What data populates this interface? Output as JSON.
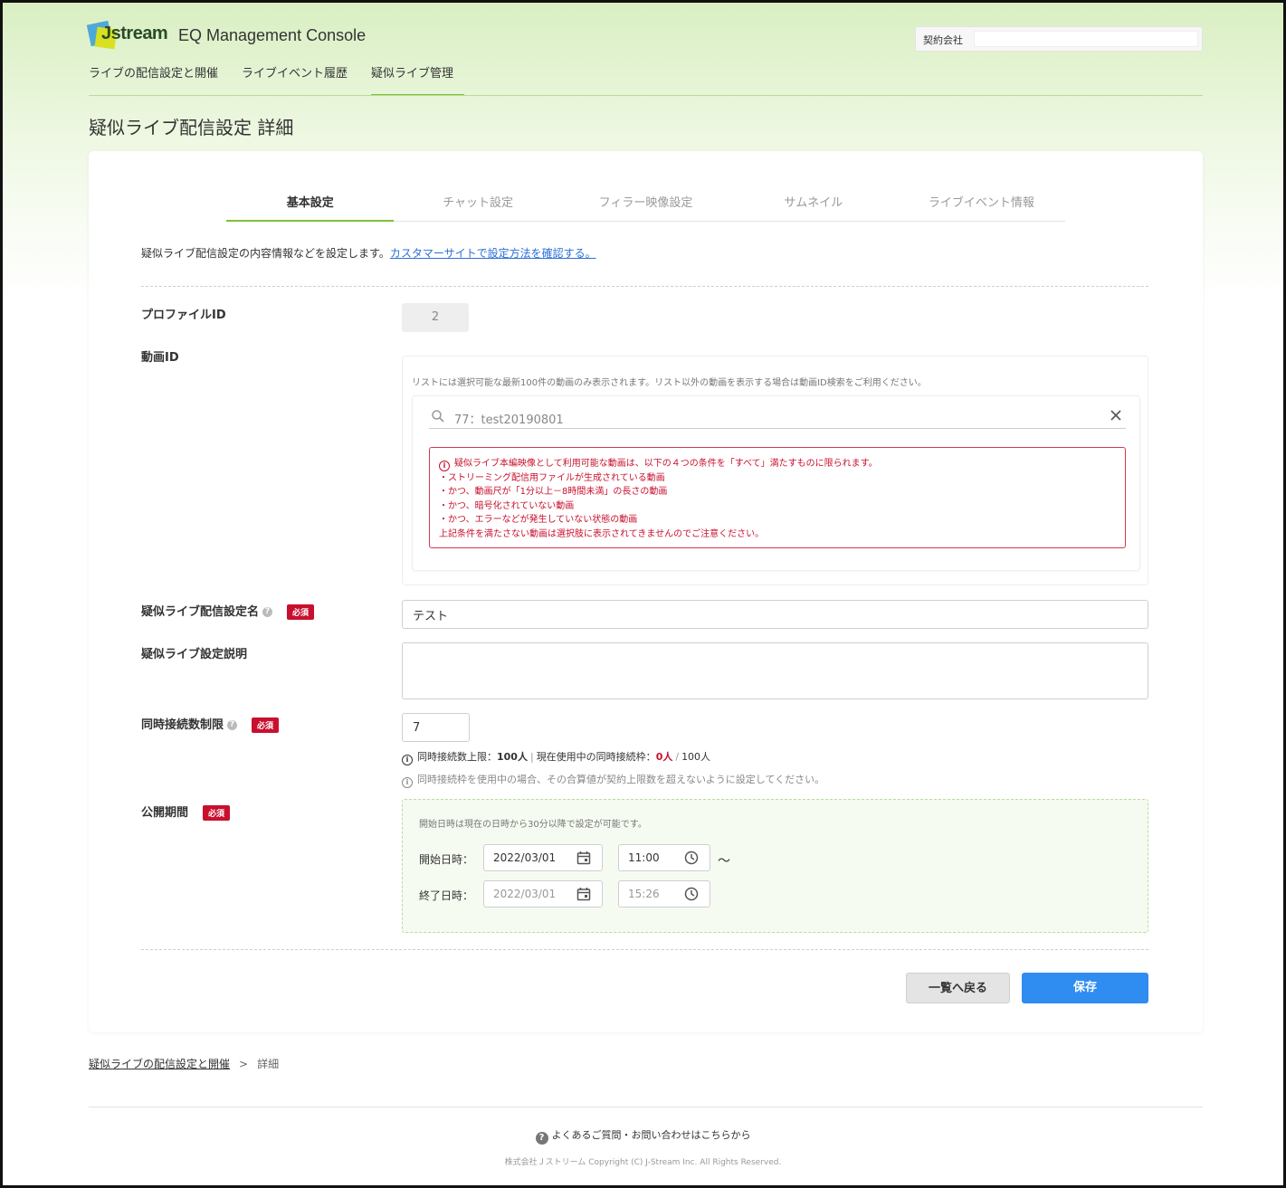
{
  "header": {
    "logo_text": "Jstream",
    "app_title": "EQ Management Console",
    "contract_label": "契約会社",
    "contract_value": ""
  },
  "nav": {
    "items": [
      {
        "label": "ライブの配信設定と開催",
        "active": false
      },
      {
        "label": "ライブイベント履歴",
        "active": false
      },
      {
        "label": "疑似ライブ管理",
        "active": true
      }
    ]
  },
  "page_title": "疑似ライブ配信設定 詳細",
  "tabs": [
    {
      "label": "基本設定",
      "active": true
    },
    {
      "label": "チャット設定",
      "active": false
    },
    {
      "label": "フィラー映像設定",
      "active": false
    },
    {
      "label": "サムネイル",
      "active": false
    },
    {
      "label": "ライブイベント情報",
      "active": false
    }
  ],
  "intro": {
    "text": "疑似ライブ配信設定の内容情報などを設定します。",
    "link": "カスタマーサイトで設定方法を確認する。"
  },
  "profile": {
    "label": "プロファイルID",
    "value": "2"
  },
  "video": {
    "label": "動画ID",
    "note": "リストには選択可能な最新100件の動画のみ表示されます。リスト以外の動画を表示する場合は動画ID検索をご利用ください。",
    "search_value": "77：test20190801",
    "warning_lines": [
      "疑似ライブ本編映像として利用可能な動画は、以下の４つの条件を「すべて」満たすものに限られます。",
      "・ストリーミング配信用ファイルが生成されている動画",
      "・かつ、動画尺が「1分以上－8時間未満」の長さの動画",
      "・かつ、暗号化されていない動画",
      "・かつ、エラーなどが発生していない状態の動画",
      "上記条件を満たさない動画は選択肢に表示されてきませんのでご注意ください。"
    ]
  },
  "name_field": {
    "label": "疑似ライブ配信設定名",
    "required": "必須",
    "value": "テスト"
  },
  "desc_field": {
    "label": "疑似ライブ設定説明",
    "value": ""
  },
  "concurrent": {
    "label": "同時接続数制限",
    "required": "必須",
    "value": "7",
    "info_upper_label": "同時接続数上限：",
    "info_upper_value": "100人",
    "info_sep": "|",
    "info_current_label": "現在使用中の同時接続枠：",
    "info_current_value": "0人",
    "info_slash": "/",
    "info_total": "100人",
    "hint": "同時接続枠を使用中の場合、その合算値が契約上限数を超えないように設定してください。"
  },
  "period": {
    "label": "公開期間",
    "required": "必須",
    "note": "開始日時は現在の日時から30分以降で設定が可能です。",
    "start_label": "開始日時：",
    "start_date": "2022/03/01",
    "start_time": "11:00",
    "tilde": "～",
    "end_label": "終了日時：",
    "end_date": "2022/03/01",
    "end_time": "15:26"
  },
  "buttons": {
    "back": "一覧へ戻る",
    "save": "保存"
  },
  "breadcrumb": {
    "link": "疑似ライブの配信設定と開催",
    "sep": ">",
    "current": "詳細"
  },
  "footer": {
    "help": "よくあるご質問・お問い合わせはこちらから",
    "copyright": "株式会社Ｊストリーム Copyright (C) J-Stream Inc. All Rights Reserved."
  },
  "colors": {
    "accent_green": "#7cc13a",
    "primary_blue": "#2f8cf0",
    "required_red": "#c8102e"
  }
}
